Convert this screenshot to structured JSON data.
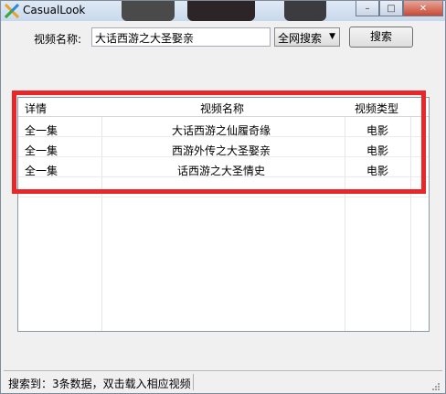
{
  "window": {
    "title": "CasualLook",
    "minimize": "–",
    "maximize": "□",
    "close": "✕"
  },
  "search": {
    "label": "视频名称:",
    "value": "大话西游之大圣娶亲",
    "scope": "全网搜索",
    "button": "搜索"
  },
  "table": {
    "columns": [
      "详情",
      "视频名称",
      "视频类型"
    ],
    "rows": [
      {
        "detail": "全一集",
        "name": "大话西游之仙履奇缘",
        "type": "电影"
      },
      {
        "detail": "全一集",
        "name": "西游外传之大圣娶亲",
        "type": "电影"
      },
      {
        "detail": "全一集",
        "name": "话西游之大圣情史",
        "type": "电影"
      }
    ]
  },
  "status": {
    "text": "搜索到：3条数据，双击载入相应视频"
  },
  "colors": {
    "highlight": "#e8272b",
    "titlebar": "#c8d8ec"
  }
}
